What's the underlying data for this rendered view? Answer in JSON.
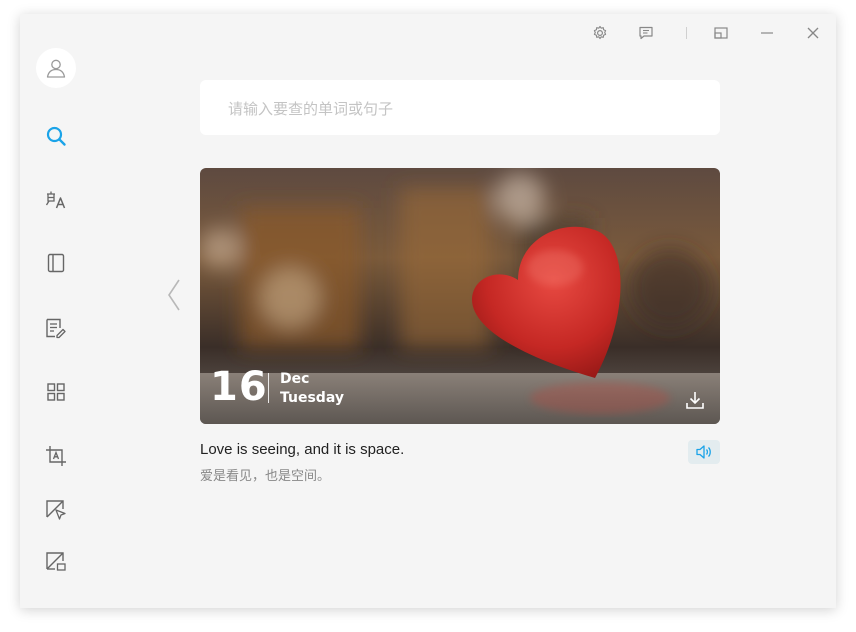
{
  "titlebar": {
    "buttons": [
      "gear-icon",
      "feedback-icon",
      "mini-mode-icon",
      "minimize-icon",
      "close-icon"
    ]
  },
  "sidebar": {
    "items": [
      {
        "icon": "search-icon",
        "active": true
      },
      {
        "icon": "translate-icon",
        "active": false
      },
      {
        "icon": "wordbook-icon",
        "active": false
      },
      {
        "icon": "document-translate-icon",
        "active": false
      },
      {
        "icon": "apps-grid-icon",
        "active": false
      },
      {
        "icon": "screenshot-translate-icon",
        "active": false
      },
      {
        "icon": "select-word-icon",
        "active": false
      },
      {
        "icon": "screen-word-icon",
        "active": false
      }
    ],
    "active_color": "#1aa3e8"
  },
  "search": {
    "placeholder": "请输入要查的单词或句子",
    "value": ""
  },
  "daily_card": {
    "day": "16",
    "month": "Dec",
    "weekday": "Tuesday",
    "quote_en": "Love is seeing, and it is space.",
    "quote_cn": "爱是看见，也是空间。"
  },
  "colors": {
    "accent": "#1aa3e8",
    "window_bg": "#f5f5f5",
    "heart": "#d8322e"
  }
}
